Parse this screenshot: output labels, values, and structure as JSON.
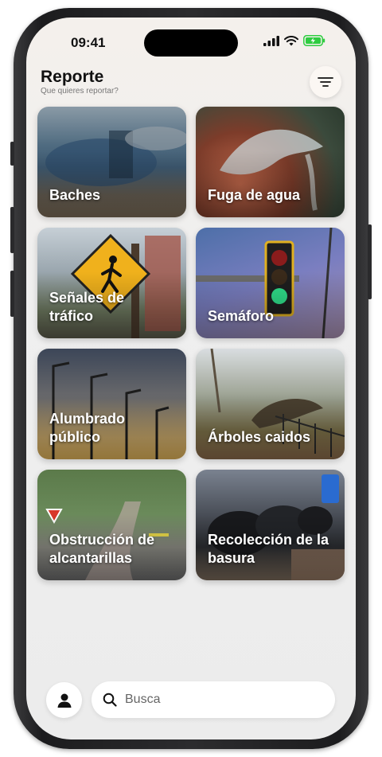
{
  "status_bar": {
    "time": "09:41"
  },
  "header": {
    "title": "Reporte",
    "subtitle": "Que quieres reportar?"
  },
  "icons": {
    "filter": "filter-lines-icon",
    "profile": "person-icon",
    "search": "magnifier-icon"
  },
  "categories": [
    {
      "label": "Baches"
    },
    {
      "label": "Fuga de agua"
    },
    {
      "label": "Señales de tráfico"
    },
    {
      "label": "Semáforo"
    },
    {
      "label": "Alumbrado público"
    },
    {
      "label": "Árboles caidos"
    },
    {
      "label": "Obstrucción de alcantarillas"
    },
    {
      "label": "Recolección de la basura"
    }
  ],
  "search": {
    "placeholder": "Busca",
    "value": ""
  },
  "colors": {
    "battery": "#2ecc40",
    "screen_bg": "#efefef"
  }
}
